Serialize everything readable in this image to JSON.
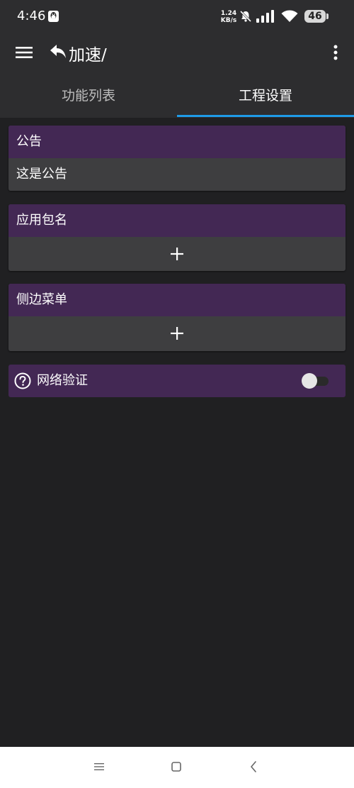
{
  "status_bar": {
    "time": "4:46",
    "net_speed_value": "1.24",
    "net_speed_unit": "KB/s",
    "battery": "46"
  },
  "app_bar": {
    "title": "加速/"
  },
  "tabs": [
    {
      "label": "功能列表",
      "selected": false
    },
    {
      "label": "工程设置",
      "selected": true
    }
  ],
  "cards": {
    "announcement": {
      "title": "公告",
      "content": "这是公告"
    },
    "package_name": {
      "title": "应用包名"
    },
    "side_menu": {
      "title": "侧边菜单"
    },
    "network_verify": {
      "label": "网络验证",
      "enabled": false
    }
  },
  "colors": {
    "background": "#202022",
    "bar": "#2d2d2f",
    "card_header": "#432854",
    "card_body": "#3e3e40",
    "accent": "#1e9be8"
  },
  "icons": {
    "status": [
      "qq-icon",
      "mute-icon",
      "signal-icon",
      "wifi-icon"
    ],
    "app_bar": [
      "menu-icon",
      "back-arrow-icon",
      "more-vert-icon"
    ],
    "nav": [
      "nav-menu-icon",
      "nav-home-icon",
      "nav-back-icon"
    ]
  }
}
